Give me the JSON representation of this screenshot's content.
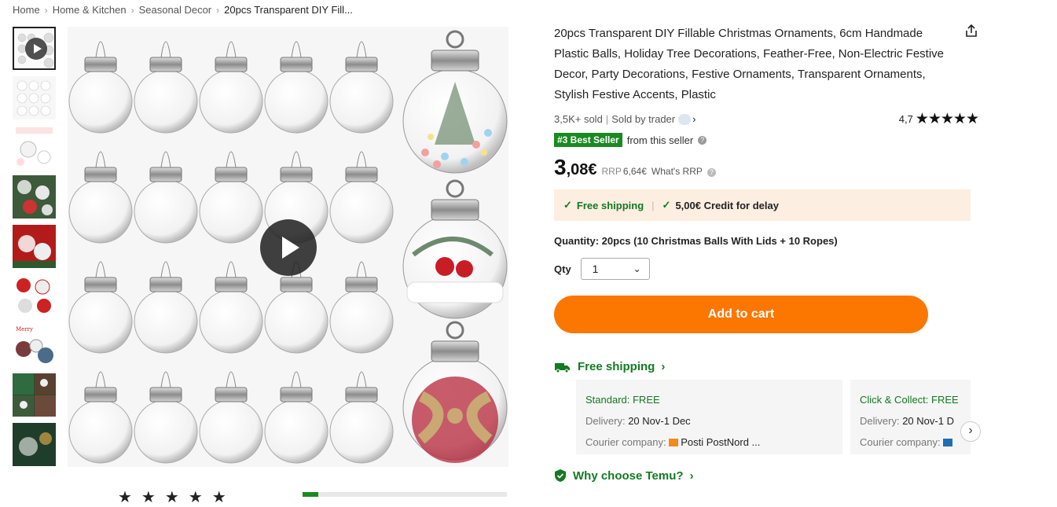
{
  "breadcrumb": {
    "items": [
      "Home",
      "Home & Kitchen",
      "Seasonal Decor"
    ],
    "current": "20pcs Transparent DIY Fill..."
  },
  "product": {
    "title": "20pcs Transparent DIY Fillable Christmas Ornaments, 6cm Handmade Plastic Balls, Holiday Tree Decorations, Feather-Free, Non-Electric Festive Decor, Party Decorations, Festive Ornaments, Transparent Ornaments, Stylish Festive Accents, Plastic",
    "sold": "3,5K+ sold",
    "sold_by": "Sold by trader",
    "rating": "4,7",
    "rating_stars": 4.7,
    "bestseller_badge": "#3 Best Seller",
    "bestseller_text": "from this seller",
    "price_int": "3",
    "price_dec": ",08€",
    "rrp_label": "RRP",
    "rrp_value": "6,64€",
    "whats_rrp": "What's RRP",
    "shipping_banner": {
      "free_shipping": "Free shipping",
      "credit": "5,00€ Credit for delay"
    },
    "quantity_text": "Quantity: 20pcs (10 Christmas Balls With Lids + 10 Ropes)",
    "qty_label": "Qty",
    "qty_value": "1",
    "add_to_cart": "Add to cart"
  },
  "shipping": {
    "heading": "Free shipping",
    "options": [
      {
        "title": "Standard: FREE",
        "delivery_label": "Delivery:",
        "delivery_value": "20 Nov-1 Dec",
        "courier_label": "Courier company:",
        "couriers": "Posti    PostNord ..."
      },
      {
        "title": "Click & Collect: FREE",
        "delivery_label": "Delivery:",
        "delivery_value": "20 Nov-1 D",
        "courier_label": "Courier company:",
        "couriers": ""
      }
    ]
  },
  "why": "Why choose Temu?",
  "colors": {
    "accent": "#fb7701",
    "green": "#137a21",
    "badge": "#1a8a22",
    "banner": "#fdeee2"
  }
}
